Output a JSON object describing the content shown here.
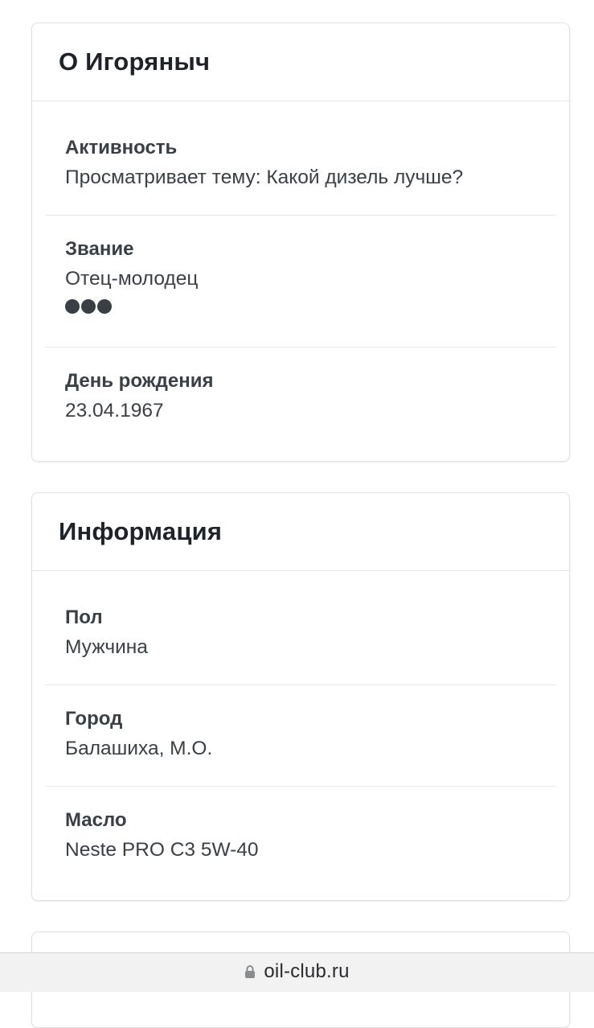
{
  "about_card": {
    "title": "О Игоряныч",
    "rows": [
      {
        "label": "Активность",
        "value": "Просматривает тему: Какой дизель лучше?"
      },
      {
        "label": "Звание",
        "value": "Отец-молодец",
        "rank_dots": 3
      },
      {
        "label": "День рождения",
        "value": "23.04.1967"
      }
    ]
  },
  "info_card": {
    "title": "Информация",
    "rows": [
      {
        "label": "Пол",
        "value": "Мужчина"
      },
      {
        "label": "Город",
        "value": "Балашиха, М.О."
      },
      {
        "label": "Масло",
        "value": "Neste PRO C3 5W-40"
      }
    ]
  },
  "browser_bar": {
    "url": "oil-club.ru",
    "icon": "lock-icon"
  },
  "colors": {
    "text": "#3a3f45",
    "title": "#1f2329",
    "border": "#dfe1e4",
    "bar_background": "#f2f2f3"
  }
}
